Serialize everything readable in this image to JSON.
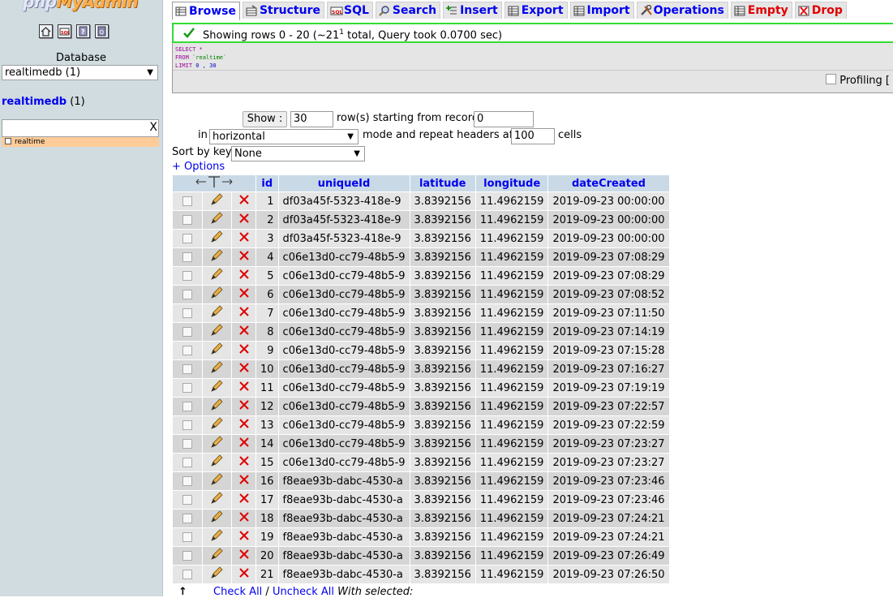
{
  "nav": {
    "logo_prefix": "php",
    "logo_brand": "MyAdmin",
    "icons": [
      "home-icon",
      "query-window-icon",
      "documentation-icon",
      "sql-docs-icon"
    ],
    "database_label": "Database",
    "database_select": "realtimedb (1)",
    "db_name": "realtimedb",
    "db_count": "(1)",
    "filter_value": "",
    "filter_clear": "X",
    "tables": [
      "realtime"
    ]
  },
  "tabs": [
    {
      "label": "Browse",
      "icon": "browse-icon",
      "active": true
    },
    {
      "label": "Structure",
      "icon": "structure-icon"
    },
    {
      "label": "SQL",
      "icon": "sql-icon"
    },
    {
      "label": "Search",
      "icon": "search-icon"
    },
    {
      "label": "Insert",
      "icon": "insert-icon"
    },
    {
      "label": "Export",
      "icon": "export-icon"
    },
    {
      "label": "Import",
      "icon": "import-icon"
    },
    {
      "label": "Operations",
      "icon": "operations-icon"
    },
    {
      "label": "Empty",
      "icon": "empty-icon",
      "danger": true
    },
    {
      "label": "Drop",
      "icon": "drop-icon",
      "danger": true
    }
  ],
  "status": {
    "text": "Showing rows 0 - 20 (~21",
    "sup": "1",
    "suffix": " total, Query took 0.0700 sec)",
    "color": "#33dd33"
  },
  "sql": {
    "line1_kw": "SELECT",
    "line1_rest": " *",
    "line2_kw": "FROM",
    "line2_table": " `realtime`",
    "line3_kw": "LIMIT",
    "line3_nums": " 0 , 30"
  },
  "profiling_label": "Profiling [",
  "navform": {
    "show_button": "Show :",
    "rows_value": "30",
    "rows_text": "row(s) starting from record #",
    "start_value": "0",
    "in_text": "in",
    "mode_value": "horizontal",
    "mode_text": "mode and repeat headers after",
    "repeat_value": "100",
    "cells_text": "cells",
    "sort_label": "Sort by key:",
    "sort_value": "None",
    "options_link": "+ Options"
  },
  "table": {
    "columns": [
      "id",
      "uniqueId",
      "latitude",
      "longitude",
      "dateCreated"
    ],
    "rows": [
      [
        "1",
        "df03a45f-5323-418e-9",
        "3.8392156",
        "11.4962159",
        "2019-09-23 00:00:00"
      ],
      [
        "2",
        "df03a45f-5323-418e-9",
        "3.8392156",
        "11.4962159",
        "2019-09-23 00:00:00"
      ],
      [
        "3",
        "df03a45f-5323-418e-9",
        "3.8392156",
        "11.4962159",
        "2019-09-23 00:00:00"
      ],
      [
        "4",
        "c06e13d0-cc79-48b5-9",
        "3.8392156",
        "11.4962159",
        "2019-09-23 07:08:29"
      ],
      [
        "5",
        "c06e13d0-cc79-48b5-9",
        "3.8392156",
        "11.4962159",
        "2019-09-23 07:08:29"
      ],
      [
        "6",
        "c06e13d0-cc79-48b5-9",
        "3.8392156",
        "11.4962159",
        "2019-09-23 07:08:52"
      ],
      [
        "7",
        "c06e13d0-cc79-48b5-9",
        "3.8392156",
        "11.4962159",
        "2019-09-23 07:11:50"
      ],
      [
        "8",
        "c06e13d0-cc79-48b5-9",
        "3.8392156",
        "11.4962159",
        "2019-09-23 07:14:19"
      ],
      [
        "9",
        "c06e13d0-cc79-48b5-9",
        "3.8392156",
        "11.4962159",
        "2019-09-23 07:15:28"
      ],
      [
        "10",
        "c06e13d0-cc79-48b5-9",
        "3.8392156",
        "11.4962159",
        "2019-09-23 07:16:27"
      ],
      [
        "11",
        "c06e13d0-cc79-48b5-9",
        "3.8392156",
        "11.4962159",
        "2019-09-23 07:19:19"
      ],
      [
        "12",
        "c06e13d0-cc79-48b5-9",
        "3.8392156",
        "11.4962159",
        "2019-09-23 07:22:57"
      ],
      [
        "13",
        "c06e13d0-cc79-48b5-9",
        "3.8392156",
        "11.4962159",
        "2019-09-23 07:22:59"
      ],
      [
        "14",
        "c06e13d0-cc79-48b5-9",
        "3.8392156",
        "11.4962159",
        "2019-09-23 07:23:27"
      ],
      [
        "15",
        "c06e13d0-cc79-48b5-9",
        "3.8392156",
        "11.4962159",
        "2019-09-23 07:23:27"
      ],
      [
        "16",
        "f8eae93b-dabc-4530-a",
        "3.8392156",
        "11.4962159",
        "2019-09-23 07:23:46"
      ],
      [
        "17",
        "f8eae93b-dabc-4530-a",
        "3.8392156",
        "11.4962159",
        "2019-09-23 07:23:46"
      ],
      [
        "18",
        "f8eae93b-dabc-4530-a",
        "3.8392156",
        "11.4962159",
        "2019-09-23 07:24:21"
      ],
      [
        "19",
        "f8eae93b-dabc-4530-a",
        "3.8392156",
        "11.4962159",
        "2019-09-23 07:24:21"
      ],
      [
        "20",
        "f8eae93b-dabc-4530-a",
        "3.8392156",
        "11.4962159",
        "2019-09-23 07:26:49"
      ],
      [
        "21",
        "f8eae93b-dabc-4530-a",
        "3.8392156",
        "11.4962159",
        "2019-09-23 07:26:50"
      ]
    ]
  },
  "footer": {
    "check_all": "Check All",
    "separator": " / ",
    "uncheck_all": "Uncheck All",
    "with_selected": " With selected:"
  }
}
